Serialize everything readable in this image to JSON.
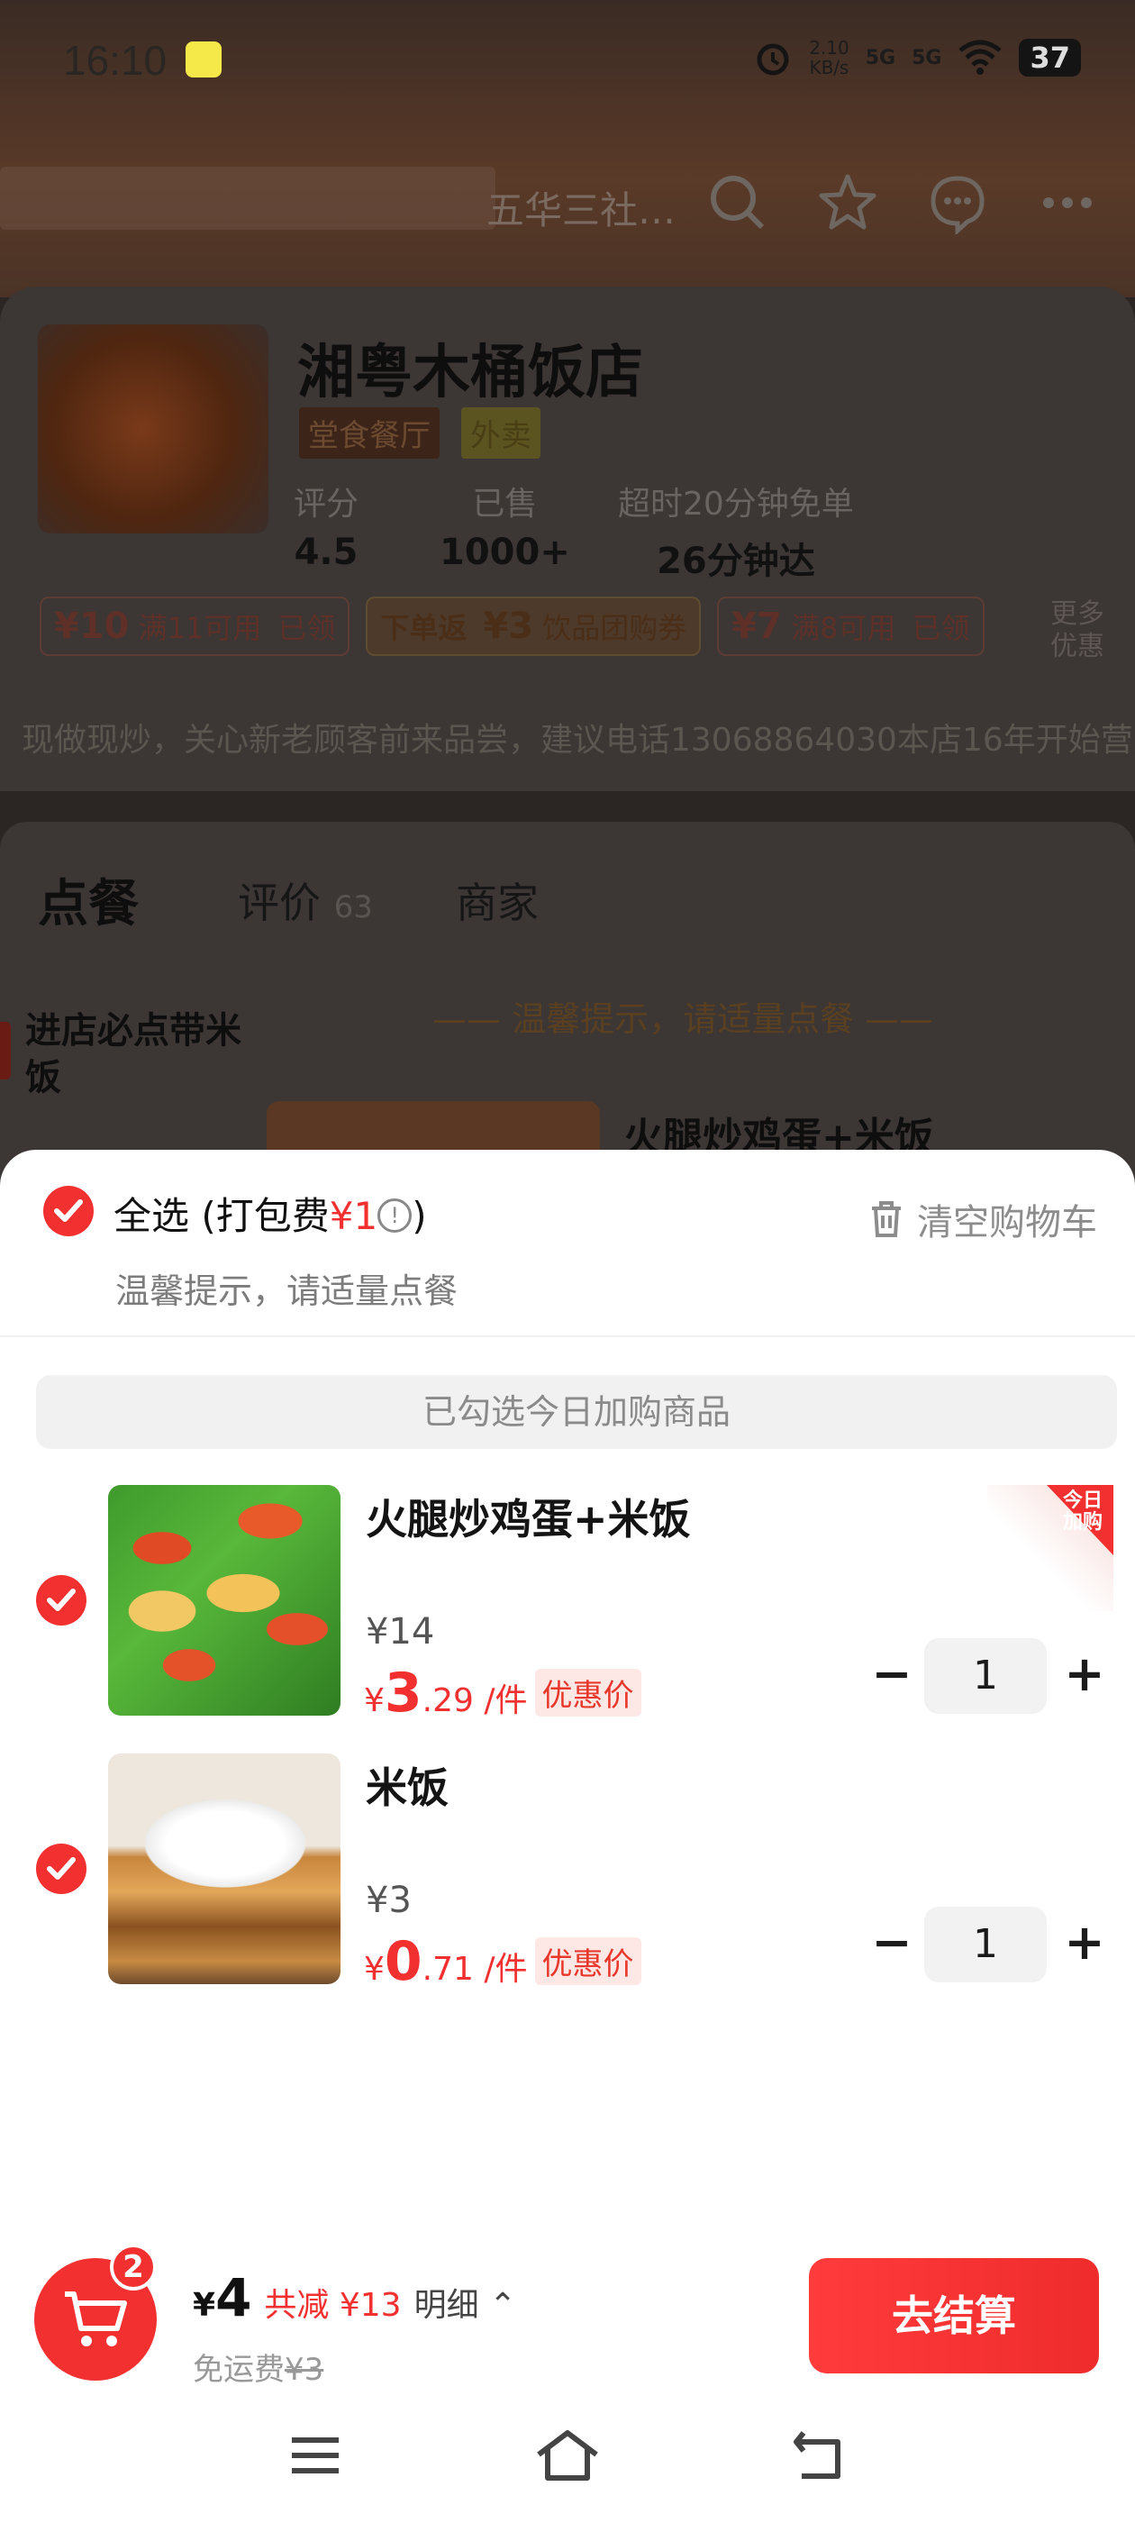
{
  "status_bar": {
    "time": "16:10",
    "speed": "2.10\nKB/s",
    "network1": "5G",
    "network2": "5G",
    "battery": "37"
  },
  "header": {
    "title_fragment": "五华三社…",
    "icons": [
      "search-icon",
      "star-icon",
      "chat-icon",
      "more-icon"
    ]
  },
  "shop": {
    "name": "湘粤木桶饭店",
    "tags": [
      "堂食餐厅",
      "外卖"
    ],
    "stats": [
      {
        "label": "评分",
        "value": "4.5"
      },
      {
        "label": "已售",
        "value": "1000+"
      },
      {
        "label": "超时20分钟免单",
        "value": "26分钟达"
      }
    ],
    "coupons": [
      {
        "amount": "¥10",
        "condition": "满11可用",
        "status": "已领"
      },
      {
        "prefix": "下单返",
        "amount": "¥3",
        "condition": "饮品团购券"
      },
      {
        "amount": "¥7",
        "condition": "满8可用",
        "status": "已领"
      }
    ],
    "more_deals": "更多\n优惠",
    "notice": "现做现炒，关心新老顾客前来品尝，建议电话13068864030本店16年开始营业"
  },
  "tabs": {
    "order": "点餐",
    "review": "评价",
    "review_count": "63",
    "merchant": "商家"
  },
  "menu": {
    "category": "进店必点带米饭",
    "warm_tip": "—— 温馨提示，请适量点餐 ——",
    "first_item": "火腿炒鸡蛋+米饭"
  },
  "cart": {
    "select_all": "全选",
    "packing_fee_prefix": " (打包费",
    "packing_fee": "¥1",
    "packing_fee_suffix": ")",
    "tip": "温馨提示，请适量点餐",
    "clear": "清空购物车",
    "banner": "已勾选今日加购商品",
    "items": [
      {
        "name": "火腿炒鸡蛋+米饭",
        "original_price": "¥14",
        "price_symbol": "¥",
        "price_int": "3",
        "price_dec": ".29",
        "unit": " /件",
        "deal_label": "优惠价",
        "qty": "1",
        "badge": "今日加购"
      },
      {
        "name": "米饭",
        "original_price": "¥3",
        "price_symbol": "¥",
        "price_int": "0",
        "price_dec": ".71",
        "unit": " /件",
        "deal_label": "优惠价",
        "qty": "1"
      }
    ]
  },
  "bottom_bar": {
    "count": "2",
    "currency": "¥",
    "total": "4",
    "saved": "共减 ¥13",
    "detail": "明细 ⌃",
    "free_shipping": "免运费",
    "shipping_fee": "¥3",
    "checkout": "去结算"
  },
  "colors": {
    "accent": "#f23030",
    "deal_bg": "#fde8e6"
  }
}
